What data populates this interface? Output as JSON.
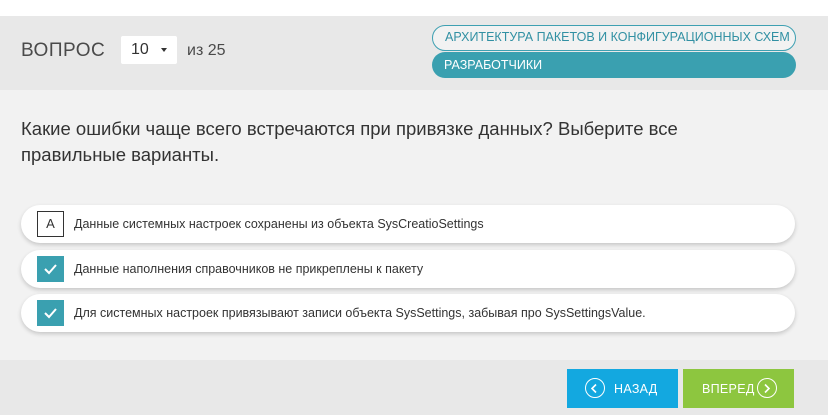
{
  "header": {
    "question_label": "ВОПРОС",
    "question_number": "10",
    "total": "из 25",
    "tags": [
      "АРХИТЕКТУРА ПАКЕТОВ И КОНФИГУРАЦИОННЫХ СХЕМ",
      "РАЗРАБОТЧИКИ"
    ]
  },
  "question": {
    "text": "Какие ошибки чаще всего встречаются при привязке данных? Выберите все правильные варианты."
  },
  "answers": [
    {
      "marker": "A",
      "checked": false,
      "text": "Данные системных настроек сохранены из объекта SysCreatioSettings"
    },
    {
      "marker": "",
      "checked": true,
      "text": "Данные наполнения справочников не прикреплены к пакету"
    },
    {
      "marker": "",
      "checked": true,
      "text": "Для системных настроек привязывают записи объекта SysSettings, забывая про SysSettingsValue."
    }
  ],
  "footer": {
    "back_label": "НАЗАД",
    "next_label": "ВПЕРЕД"
  },
  "icons": {
    "check": "check-icon",
    "back": "chevron-left-icon",
    "next": "chevron-right-icon",
    "dropdown": "caret-down-icon"
  },
  "colors": {
    "accent": "#3aa0b0",
    "back_button": "#13a8e0",
    "next_button": "#8dc63f"
  }
}
